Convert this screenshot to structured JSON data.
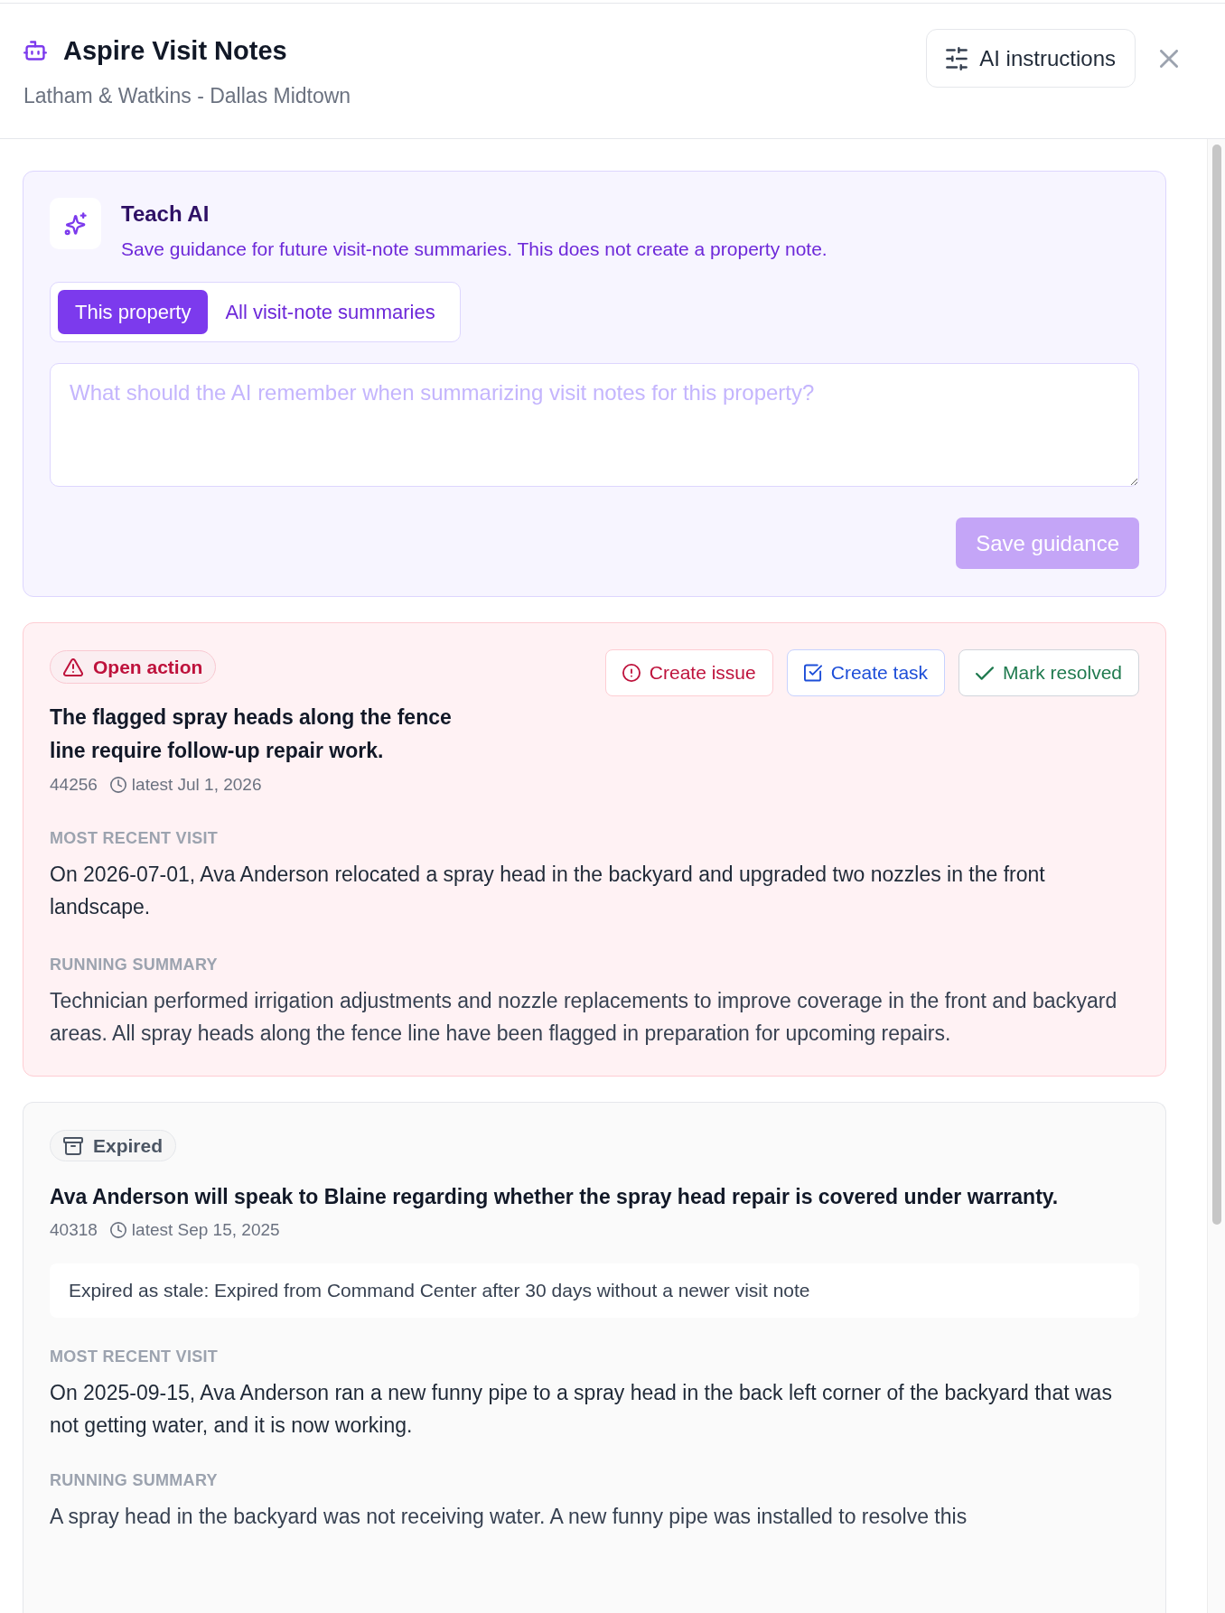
{
  "header": {
    "title": "Aspire Visit Notes",
    "subtitle": "Latham & Watkins - Dallas Midtown",
    "instructions_button": "AI instructions"
  },
  "teach_ai": {
    "title": "Teach AI",
    "description": "Save guidance for future visit-note summaries. This does not create a property note.",
    "scope_tabs": [
      {
        "label": "This property",
        "selected": true
      },
      {
        "label": "All visit-note summaries",
        "selected": false
      }
    ],
    "guidance_field": {
      "placeholder": "What should the AI remember when summarizing visit notes for this property?"
    },
    "save_button": {
      "label": "Save guidance",
      "disabled": true
    }
  },
  "notes": [
    {
      "kind": "open",
      "status": "Open action",
      "actions": [
        {
          "kind": "issue",
          "label": "Create issue"
        },
        {
          "kind": "task",
          "label": "Create task"
        },
        {
          "kind": "resolve",
          "label": "Mark resolved"
        }
      ],
      "title": "The flagged spray heads along the fence line require follow-up repair work.",
      "number": "44256",
      "latest": "latest Jul 1, 2026",
      "sections": [
        {
          "label": "MOST RECENT VISIT",
          "text": "On 2026-07-01, Ava Anderson relocated a spray head in the backyard and upgraded two nozzles in the front landscape."
        },
        {
          "label": "RUNNING SUMMARY",
          "text": "Technician performed irrigation adjustments and nozzle replacements to improve coverage in the front and backyard areas. All spray heads along the fence line have been flagged in preparation for upcoming repairs."
        }
      ]
    },
    {
      "kind": "expired",
      "status": "Expired",
      "title": "Ava Anderson will speak to Blaine regarding whether the spray head repair is covered under warranty.",
      "number": "40318",
      "latest": "latest Sep 15, 2025",
      "reason": "Expired as stale: Expired from Command Center after 30 days without a newer visit note",
      "sections": [
        {
          "label": "MOST RECENT VISIT",
          "text": "On 2025-09-15, Ava Anderson ran a new funny pipe to a spray head in the back left corner of the backyard that was not getting water, and it is now working."
        },
        {
          "label": "RUNNING SUMMARY",
          "text": "A spray head in the backyard was not receiving water. A new funny pipe was installed to resolve this"
        }
      ]
    }
  ]
}
